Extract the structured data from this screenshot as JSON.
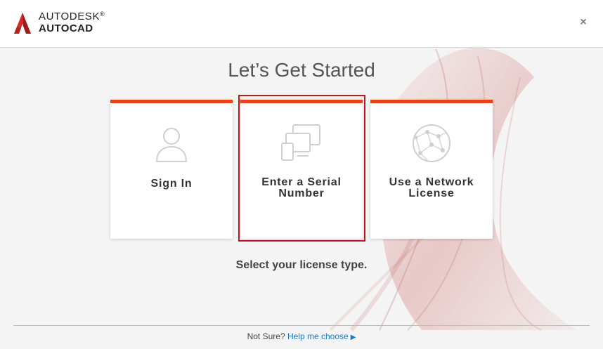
{
  "header": {
    "company": "AUTODESK",
    "registered_mark": "®",
    "product": "AUTOCAD",
    "close_glyph": "×",
    "logo_icon": "autodesk-a-icon"
  },
  "main": {
    "title": "Let’s Get Started",
    "subtitle": "Select your license type."
  },
  "cards": [
    {
      "label": "Sign In",
      "icon": "person-icon"
    },
    {
      "label_line1": "Enter a Serial",
      "label_line2": "Number",
      "icon": "devices-icon",
      "selected": true
    },
    {
      "label_line1": "Use a Network",
      "label_line2": "License",
      "icon": "network-globe-icon"
    }
  ],
  "footer": {
    "prompt": "Not Sure?",
    "link": "Help me choose",
    "arrow": "▶"
  },
  "colors": {
    "accent_bar": "#e8401c",
    "selection_border": "#c4161c",
    "link": "#1a79c6",
    "logo_red": "#d42c2c"
  }
}
